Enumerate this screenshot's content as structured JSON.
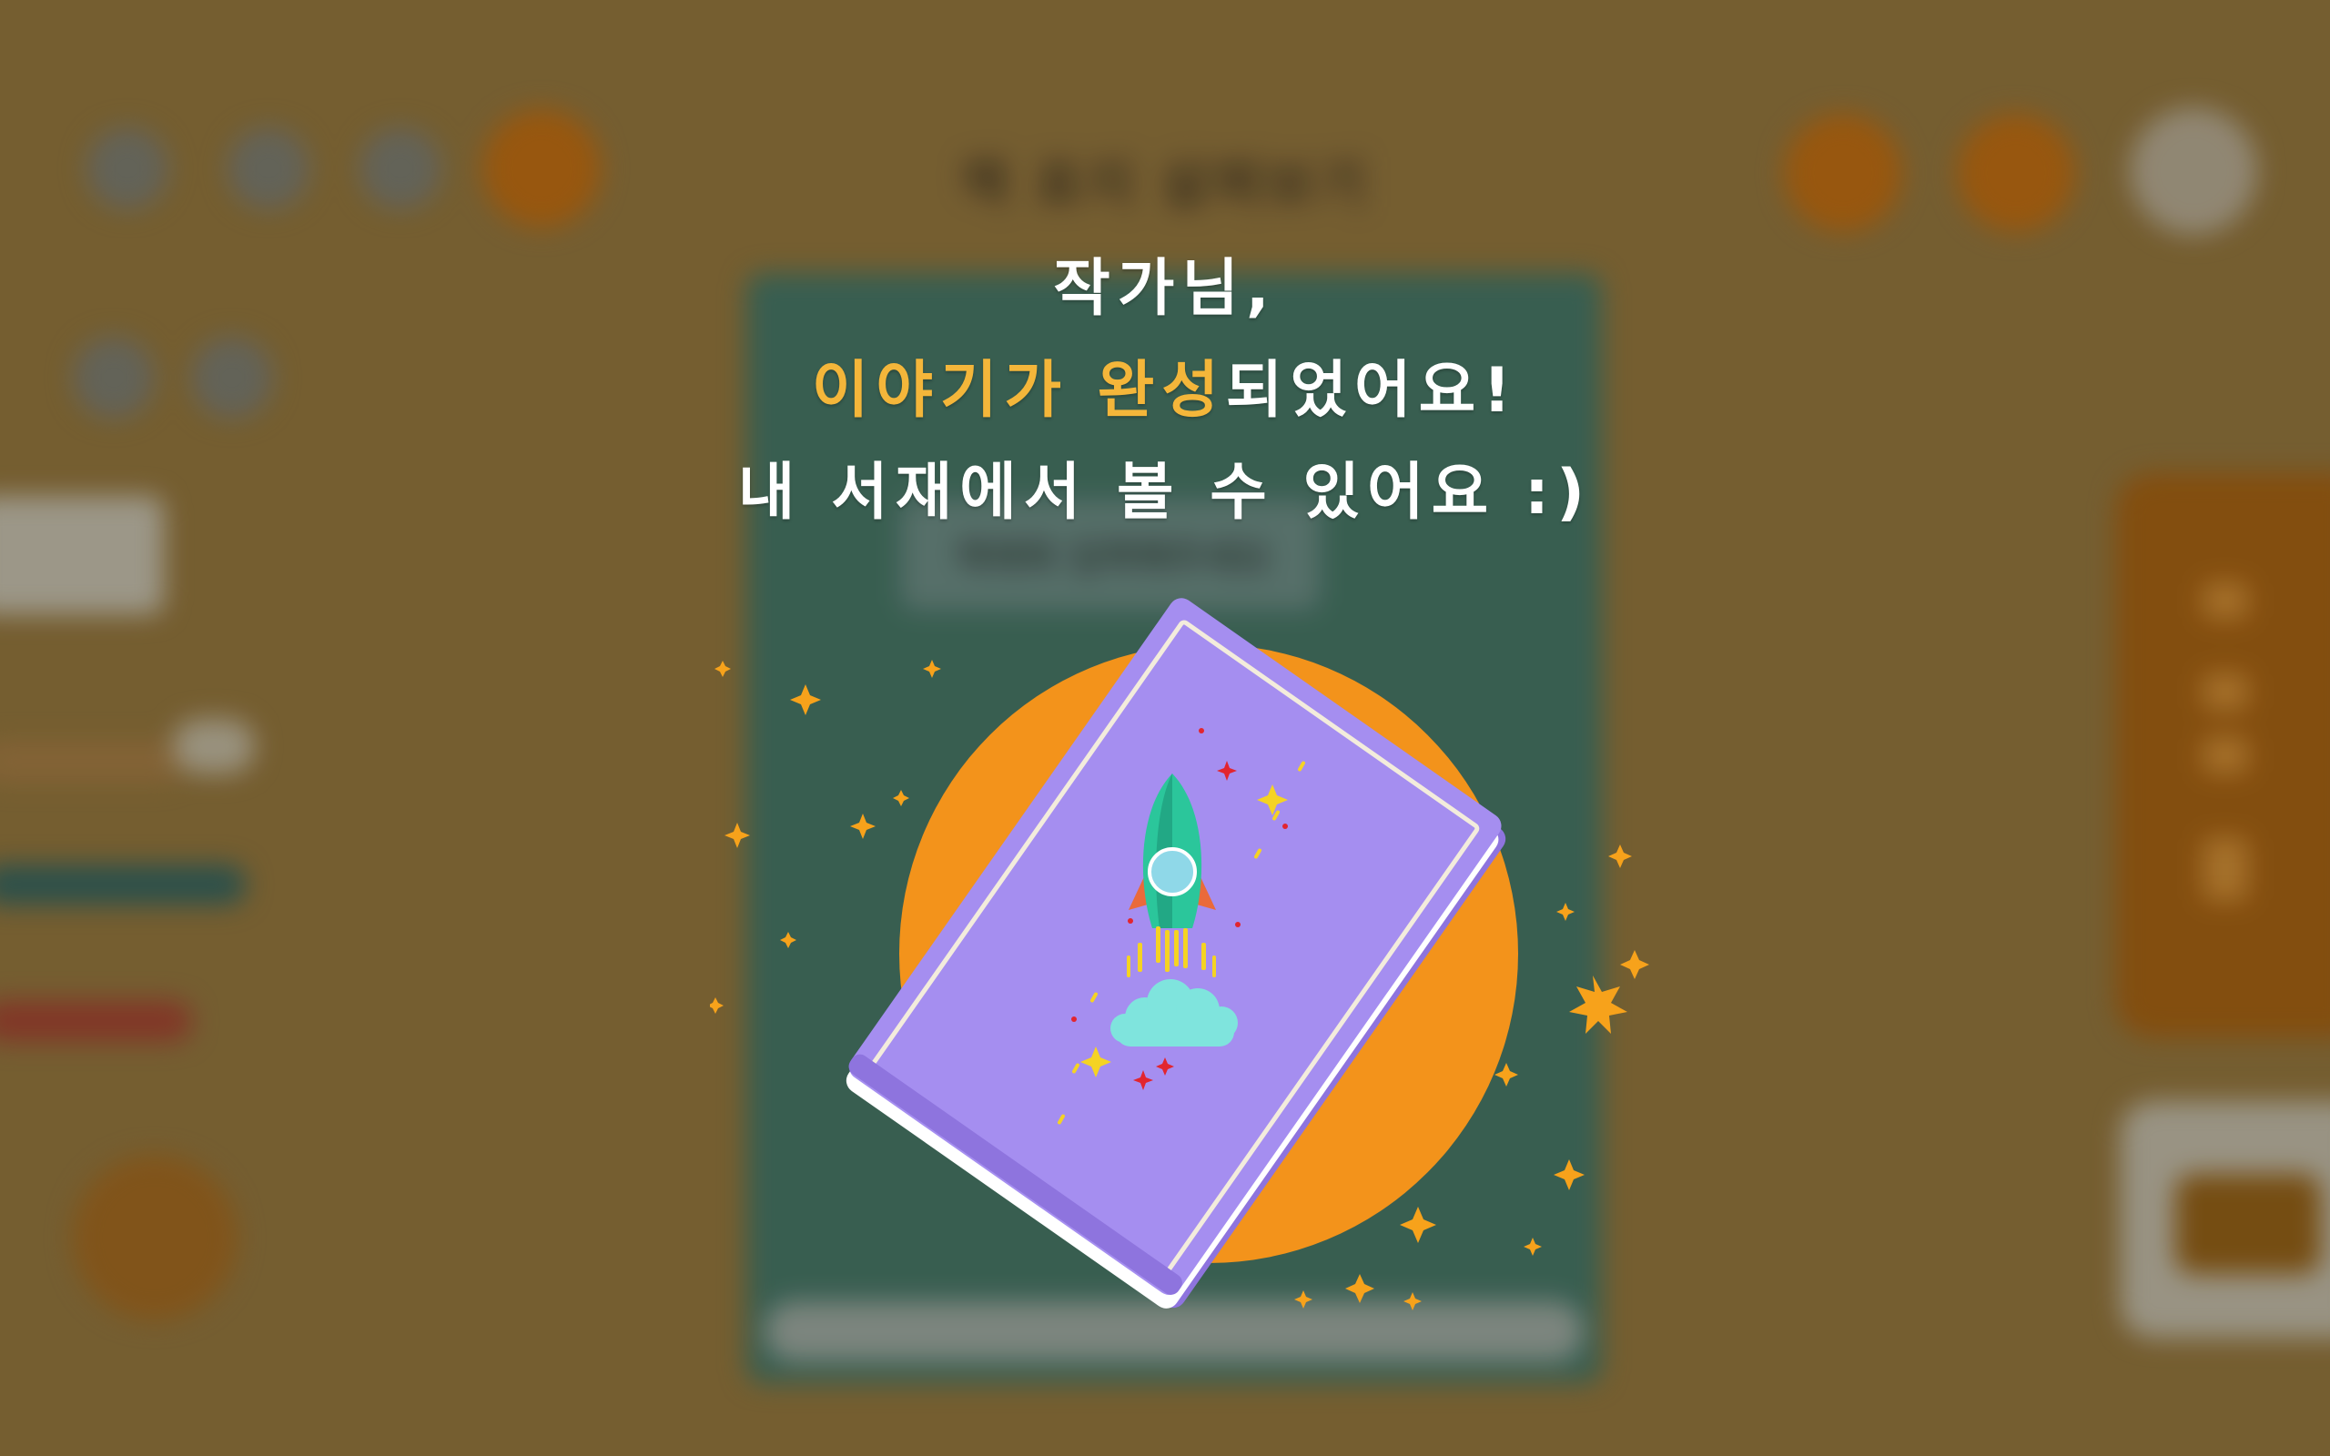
{
  "colors": {
    "background": "#7d6434",
    "highlight": "#f4b63a",
    "message_text": "#ffffff",
    "orange_circle": "#f3931b",
    "book_cover": "#a58ef0",
    "book_pages": "#ffffff",
    "rocket_body": "#2bc69b",
    "smoke": "#7fe4dd",
    "sparkle": "#f7a21b"
  },
  "background_app": {
    "title": "책 표지 살펴보기",
    "toolbar_left_icons": [
      "home-icon",
      "menu-icon",
      "list-icon",
      "settings-icon"
    ],
    "toolbar_right_icons": [
      "save-icon",
      "share-icon",
      "profile-icon"
    ],
    "secondary_icons": [
      "undo-icon",
      "redo-icon"
    ],
    "book_card_header": "책제목 입력해주세요",
    "record_icon": "record-icon"
  },
  "message": {
    "line1": "작가님,",
    "line2_highlight_1": "이야기가",
    "line2_space": " ",
    "line2_highlight_2": "완성",
    "line2_rest": "되었어요!",
    "line3": "내 서재에서 볼 수 있어요 :)"
  },
  "illustration": {
    "icon": "rocket-book-icon"
  }
}
